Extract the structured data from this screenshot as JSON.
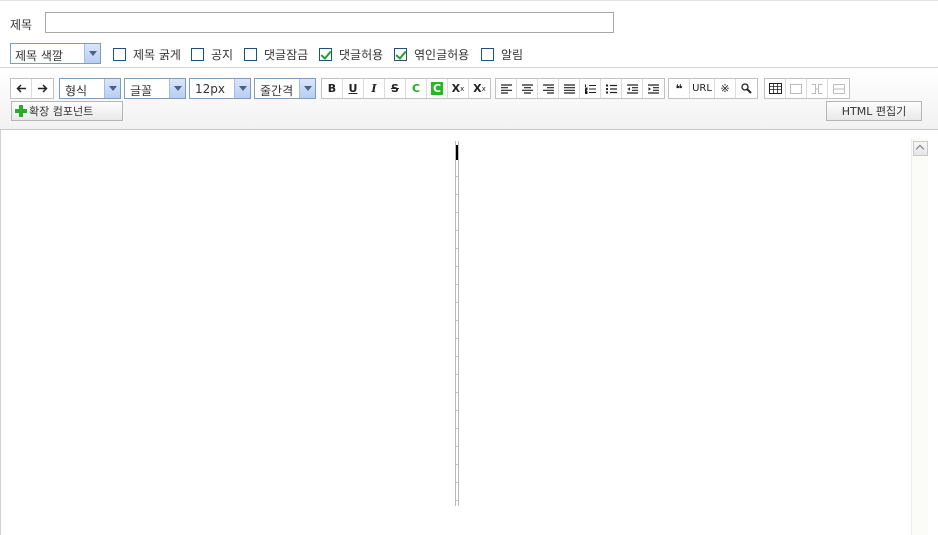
{
  "title_row": {
    "label": "제목",
    "value": "",
    "placeholder": ""
  },
  "options": {
    "title_color": {
      "selected": "제목 색깔"
    },
    "checkboxes": [
      {
        "label": "제목 굵게",
        "checked": false
      },
      {
        "label": "공지",
        "checked": false
      },
      {
        "label": "댓글잠금",
        "checked": false
      },
      {
        "label": "댓글허용",
        "checked": true
      },
      {
        "label": "엮인글허용",
        "checked": true
      },
      {
        "label": "알림",
        "checked": false
      }
    ]
  },
  "toolbar": {
    "format_select": "형식",
    "font_select": "글꼴",
    "size_select": "12px",
    "line_height_select": "줄간격",
    "bold": "B",
    "underline": "U",
    "italic": "I",
    "strike": "S",
    "font_color": "C",
    "bg_color": "C",
    "superscript": "X",
    "superscript_mark": "x",
    "subscript": "X",
    "subscript_mark": "x",
    "quote": "❝",
    "url": "URL",
    "special_char": "※",
    "extension_component_label": "확장 컴포넌트",
    "html_editor_label": "HTML 편집기"
  },
  "colors": {
    "accent_check": "#21a121",
    "font_color_btn": "#22aa22",
    "bg_color_btn": "#22bb22",
    "plus": "#2eaa2e"
  }
}
